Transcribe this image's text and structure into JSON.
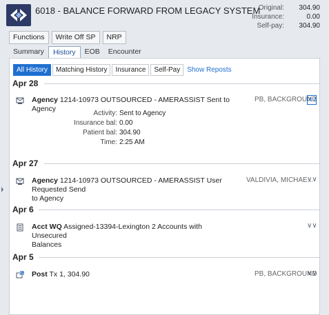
{
  "header": {
    "title": "6018 - BALANCE FORWARD FROM LEGACY SYSTEM",
    "totals": [
      {
        "label": "Original:",
        "value": "304.90"
      },
      {
        "label": "Insurance:",
        "value": "0.00"
      },
      {
        "label": "Self-pay:",
        "value": "304.90"
      }
    ]
  },
  "actions": [
    "Functions",
    "Write Off SP",
    "NRP"
  ],
  "tabs": [
    "Summary",
    "History",
    "EOB",
    "Encounter"
  ],
  "filters": [
    "All History",
    "Matching History",
    "Insurance",
    "Self-Pay"
  ],
  "filter_link": "Show Reposts",
  "groups": [
    {
      "date": "Apr 28",
      "entries": [
        {
          "icon": "agency-icon",
          "type": "Agency",
          "text": "1214-10973 OUTSOURCED - AMERASSIST Sent to Agency",
          "text2": "",
          "who": "PB, BACKGROUND",
          "details": [
            {
              "label": "Activity:",
              "value": "Sent to Agency"
            },
            {
              "label": "Insurance bal:",
              "value": "0.00"
            },
            {
              "label": "Patient bal:",
              "value": "304.90"
            },
            {
              "label": "Time:",
              "value": "2:25 AM"
            }
          ]
        }
      ]
    },
    {
      "date": "Apr 27",
      "entries": [
        {
          "icon": "agency-icon",
          "type": "Agency",
          "text": "1214-10973 OUTSOURCED - AMERASSIST User Requested Send",
          "text2": "to Agency",
          "who": "VALDIVIA, MICHAE..."
        }
      ]
    },
    {
      "date": "Apr 6",
      "entries": [
        {
          "icon": "workqueue-icon",
          "type": "Acct WQ",
          "text": "Assigned-13394-Lexington 2 Accounts with Unsecured",
          "text2": "Balances",
          "who": ""
        }
      ]
    },
    {
      "date": "Apr 5",
      "entries": [
        {
          "icon": "post-icon",
          "type": "Post",
          "text": "Tx 1, 304.90",
          "text2": "",
          "who": "PB, BACKGROUND"
        }
      ]
    }
  ]
}
